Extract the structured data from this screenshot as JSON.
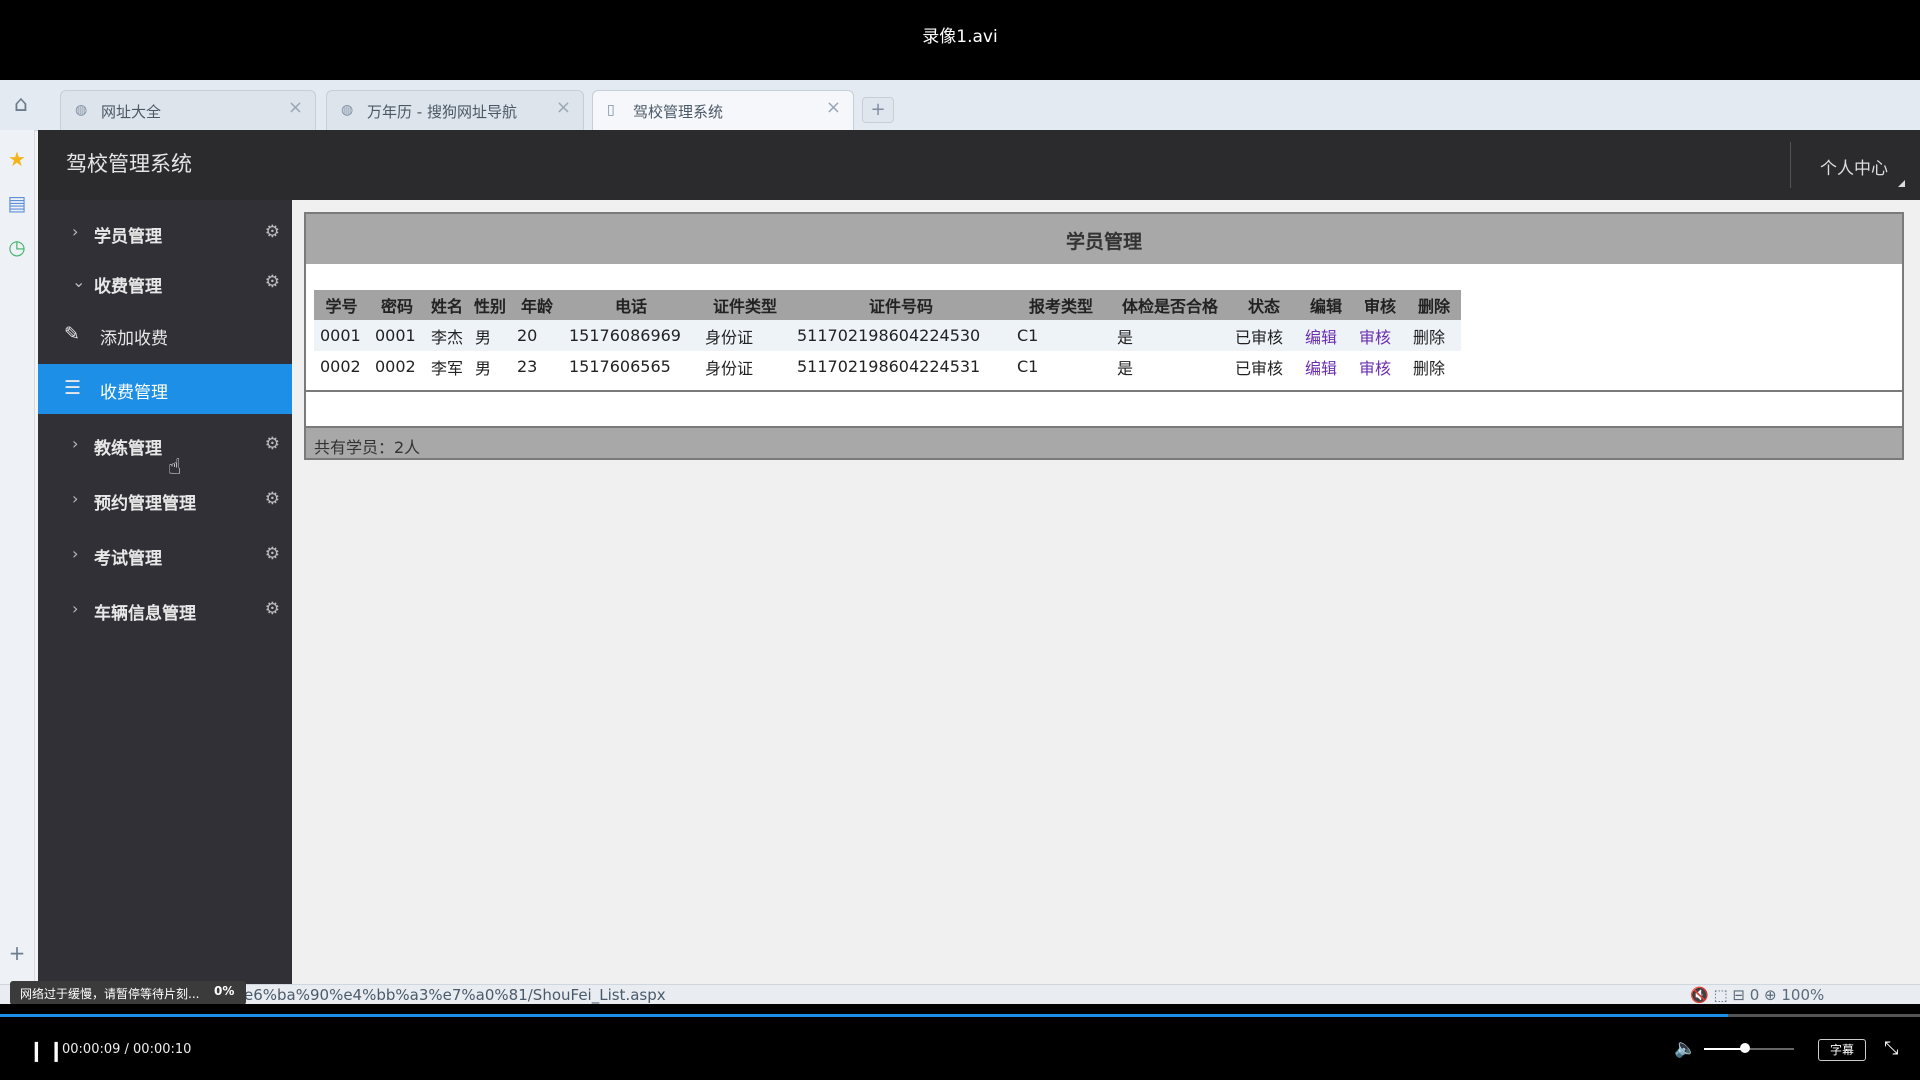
{
  "player": {
    "title": "录像1.avi",
    "time": "00:00:09 / 00:00:10",
    "pause_glyph": "❙❙",
    "subtitle_label": "字幕",
    "buffer_message": "网络过于缓慢，请暂停等待片刻...",
    "buffer_percent": "0%",
    "progress_fraction": 0.9,
    "volume_fraction": 0.45,
    "accent": "#1e8fe6"
  },
  "browser": {
    "tabs": [
      {
        "label": "网址大全",
        "icon": "globe-icon"
      },
      {
        "label": "万年历 - 搜狗网址导航",
        "icon": "globe-icon"
      },
      {
        "label": "驾校管理系统",
        "icon": "page-icon"
      }
    ],
    "new_tab_label": "+",
    "status_url": "e6%ba%90%e4%bb%a3%e7%a0%81/ShouFei_List.aspx",
    "status_right": "🔇  ⬚  ⊟ 0  ⊕ 100%",
    "add_label": "+"
  },
  "app": {
    "title": "驾校管理系统",
    "user_center": "个人中心",
    "nav": {
      "student": "学员管理",
      "fees": "收费管理",
      "add_fee": "添加收费",
      "fee_manage": "收费管理",
      "coach": "教练管理",
      "booking": "预约管理管理",
      "exam": "考试管理",
      "vehicle": "车辆信息管理"
    },
    "panel_title": "学员管理",
    "table": {
      "headers": [
        "学号",
        "密码",
        "姓名",
        "性别",
        "年龄",
        "电话",
        "证件类型",
        "证件号码",
        "报考类型",
        "体检是否合格",
        "状态",
        "编辑",
        "审核",
        "删除"
      ],
      "rows": [
        [
          "0001",
          "0001",
          "李杰",
          "男",
          "20",
          "15176086969",
          "身份证",
          "511702198604224530",
          "C1",
          "是",
          "已审核",
          "编辑",
          "审核",
          "删除"
        ],
        [
          "0002",
          "0002",
          "李军",
          "男",
          "23",
          "1517606565",
          "身份证",
          "511702198604224531",
          "C1",
          "是",
          "已审核",
          "编辑",
          "审核",
          "删除"
        ]
      ]
    },
    "footer_text": "共有学员：2人"
  }
}
